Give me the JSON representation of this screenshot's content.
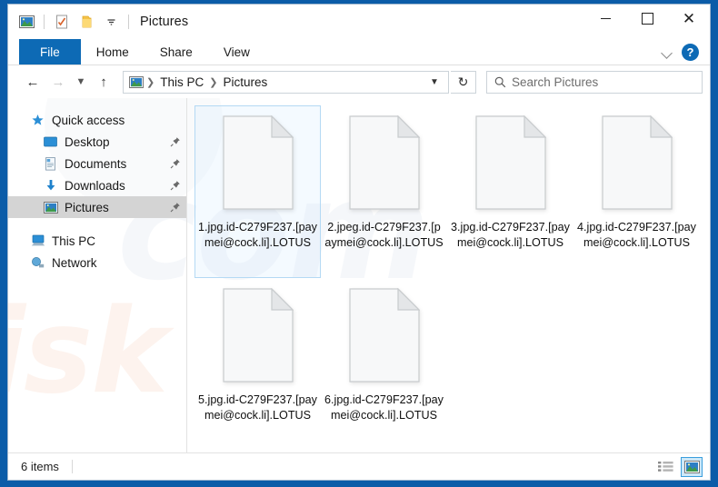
{
  "window": {
    "title": "Pictures",
    "quick_access_toolbar": [
      {
        "name": "pictures-folder-icon",
        "label": "Pictures"
      },
      {
        "name": "properties-icon",
        "label": "Properties"
      },
      {
        "name": "new-folder-icon",
        "label": "New folder"
      },
      {
        "name": "customize-qat-dropdown-icon",
        "label": "Customize Quick Access Toolbar"
      }
    ],
    "controls": {
      "minimize": "Minimize",
      "maximize": "Maximize",
      "close": "Close",
      "ribbon_toggle": "Minimize the Ribbon",
      "help": "?"
    }
  },
  "ribbon": {
    "tabs": [
      {
        "label": "File",
        "active": true
      },
      {
        "label": "Home",
        "active": false
      },
      {
        "label": "Share",
        "active": false
      },
      {
        "label": "View",
        "active": false
      }
    ]
  },
  "navbar": {
    "back": "Back",
    "forward": "Forward",
    "recent": "Recent locations",
    "up": "Up",
    "breadcrumb": [
      {
        "label": "This PC"
      },
      {
        "label": "Pictures"
      }
    ],
    "refresh": "Refresh",
    "address_dropdown": "Previous locations"
  },
  "search": {
    "placeholder": "Search Pictures",
    "value": "",
    "icon": "search-icon"
  },
  "sidebar": {
    "items": [
      {
        "label": "Quick access",
        "icon": "star-pin-icon",
        "indent": false,
        "pinned": false,
        "selected": false
      },
      {
        "label": "Desktop",
        "icon": "desktop-icon",
        "indent": true,
        "pinned": true,
        "selected": false
      },
      {
        "label": "Documents",
        "icon": "documents-icon",
        "indent": true,
        "pinned": true,
        "selected": false
      },
      {
        "label": "Downloads",
        "icon": "downloads-icon",
        "indent": true,
        "pinned": true,
        "selected": false
      },
      {
        "label": "Pictures",
        "icon": "pictures-icon",
        "indent": true,
        "pinned": true,
        "selected": true
      },
      {
        "label": "This PC",
        "icon": "this-pc-icon",
        "indent": false,
        "pinned": false,
        "selected": false
      },
      {
        "label": "Network",
        "icon": "network-icon",
        "indent": false,
        "pinned": false,
        "selected": false
      }
    ]
  },
  "files": [
    {
      "name": "1.jpg.id-C279F237.[paymei@cock.li].LOTUS",
      "icon": "blank-document-icon",
      "selected": true
    },
    {
      "name": "2.jpeg.id-C279F237.[paymei@cock.li].LOTUS",
      "icon": "blank-document-icon",
      "selected": false
    },
    {
      "name": "3.jpg.id-C279F237.[paymei@cock.li].LOTUS",
      "icon": "blank-document-icon",
      "selected": false
    },
    {
      "name": "4.jpg.id-C279F237.[paymei@cock.li].LOTUS",
      "icon": "blank-document-icon",
      "selected": false
    },
    {
      "name": "5.jpg.id-C279F237.[paymei@cock.li].LOTUS",
      "icon": "blank-document-icon",
      "selected": false
    },
    {
      "name": "6.jpg.id-C279F237.[paymei@cock.li].LOTUS",
      "icon": "blank-document-icon",
      "selected": false
    }
  ],
  "watermark": {
    "line1": "risk",
    "line2": "com"
  },
  "statusbar": {
    "item_count": "6 items",
    "views": [
      {
        "name": "details-view-button",
        "label": "Details view",
        "active": false
      },
      {
        "name": "large-icons-view-button",
        "label": "Large icons view",
        "active": true
      }
    ]
  },
  "colors": {
    "accent": "#0d6ab5",
    "desktop": "#0b5ca8",
    "selection": "#cde8f8",
    "selected_nav": "#d4d4d4"
  }
}
